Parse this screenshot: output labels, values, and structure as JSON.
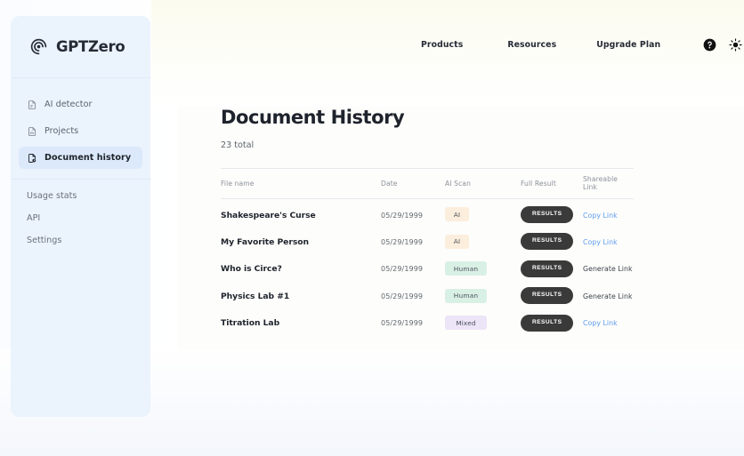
{
  "brand": {
    "name": "GPTZero",
    "logo_icon": "gptzero-spiral-logo-icon"
  },
  "sidebar": {
    "primary_items": [
      {
        "label": "AI detector",
        "icon": "document-ai-icon",
        "active": false
      },
      {
        "label": "Projects",
        "icon": "document-chart-icon",
        "active": false
      },
      {
        "label": "Document history",
        "icon": "document-history-icon",
        "active": true
      }
    ],
    "secondary_items": [
      {
        "label": "Usage stats"
      },
      {
        "label": "API"
      },
      {
        "label": "Settings"
      }
    ]
  },
  "topnav": {
    "links": [
      {
        "label": "Products"
      },
      {
        "label": "Resources"
      },
      {
        "label": "Upgrade Plan"
      }
    ],
    "icons": [
      {
        "name": "help-circle-icon"
      },
      {
        "name": "brightness-sun-icon"
      },
      {
        "name": "account-circle-icon"
      }
    ]
  },
  "main": {
    "title": "Document History",
    "total_label": "23 total",
    "table": {
      "columns": [
        "File name",
        "Date",
        "AI Scan",
        "Full Result",
        "Shareable Link"
      ],
      "rows": [
        {
          "file_name": "Shakespeare's Curse",
          "date": "05/29/1999",
          "ai_scan": "AI",
          "ai_scan_type": "ai",
          "full_result": "RESULTS",
          "share_label": "Copy Link",
          "share_type": "copy"
        },
        {
          "file_name": "My Favorite Person",
          "date": "05/29/1999",
          "ai_scan": "AI",
          "ai_scan_type": "ai",
          "full_result": "RESULTS",
          "share_label": "Copy Link",
          "share_type": "copy"
        },
        {
          "file_name": "Who is Circe?",
          "date": "05/29/1999",
          "ai_scan": "Human",
          "ai_scan_type": "human",
          "full_result": "RESULTS",
          "share_label": "Generate Link",
          "share_type": "generate"
        },
        {
          "file_name": "Physics Lab #1",
          "date": "05/29/1999",
          "ai_scan": "Human",
          "ai_scan_type": "human",
          "full_result": "RESULTS",
          "share_label": "Generate Link",
          "share_type": "generate"
        },
        {
          "file_name": "Titration Lab",
          "date": "05/29/1999",
          "ai_scan": "Mixed",
          "ai_scan_type": "mixed",
          "full_result": "RESULTS",
          "share_label": "Copy Link",
          "share_type": "copy"
        }
      ]
    }
  },
  "colors": {
    "sidebar_bg": "#ebf3fd",
    "sidebar_active_bg": "#dce9fb",
    "badge_ai": "#fceedd",
    "badge_human": "#d9f0e5",
    "badge_mixed": "#ece4f7",
    "results_button": "#3a3a3a",
    "copy_link": "#5e9cf0",
    "text_primary": "#1e232c"
  }
}
